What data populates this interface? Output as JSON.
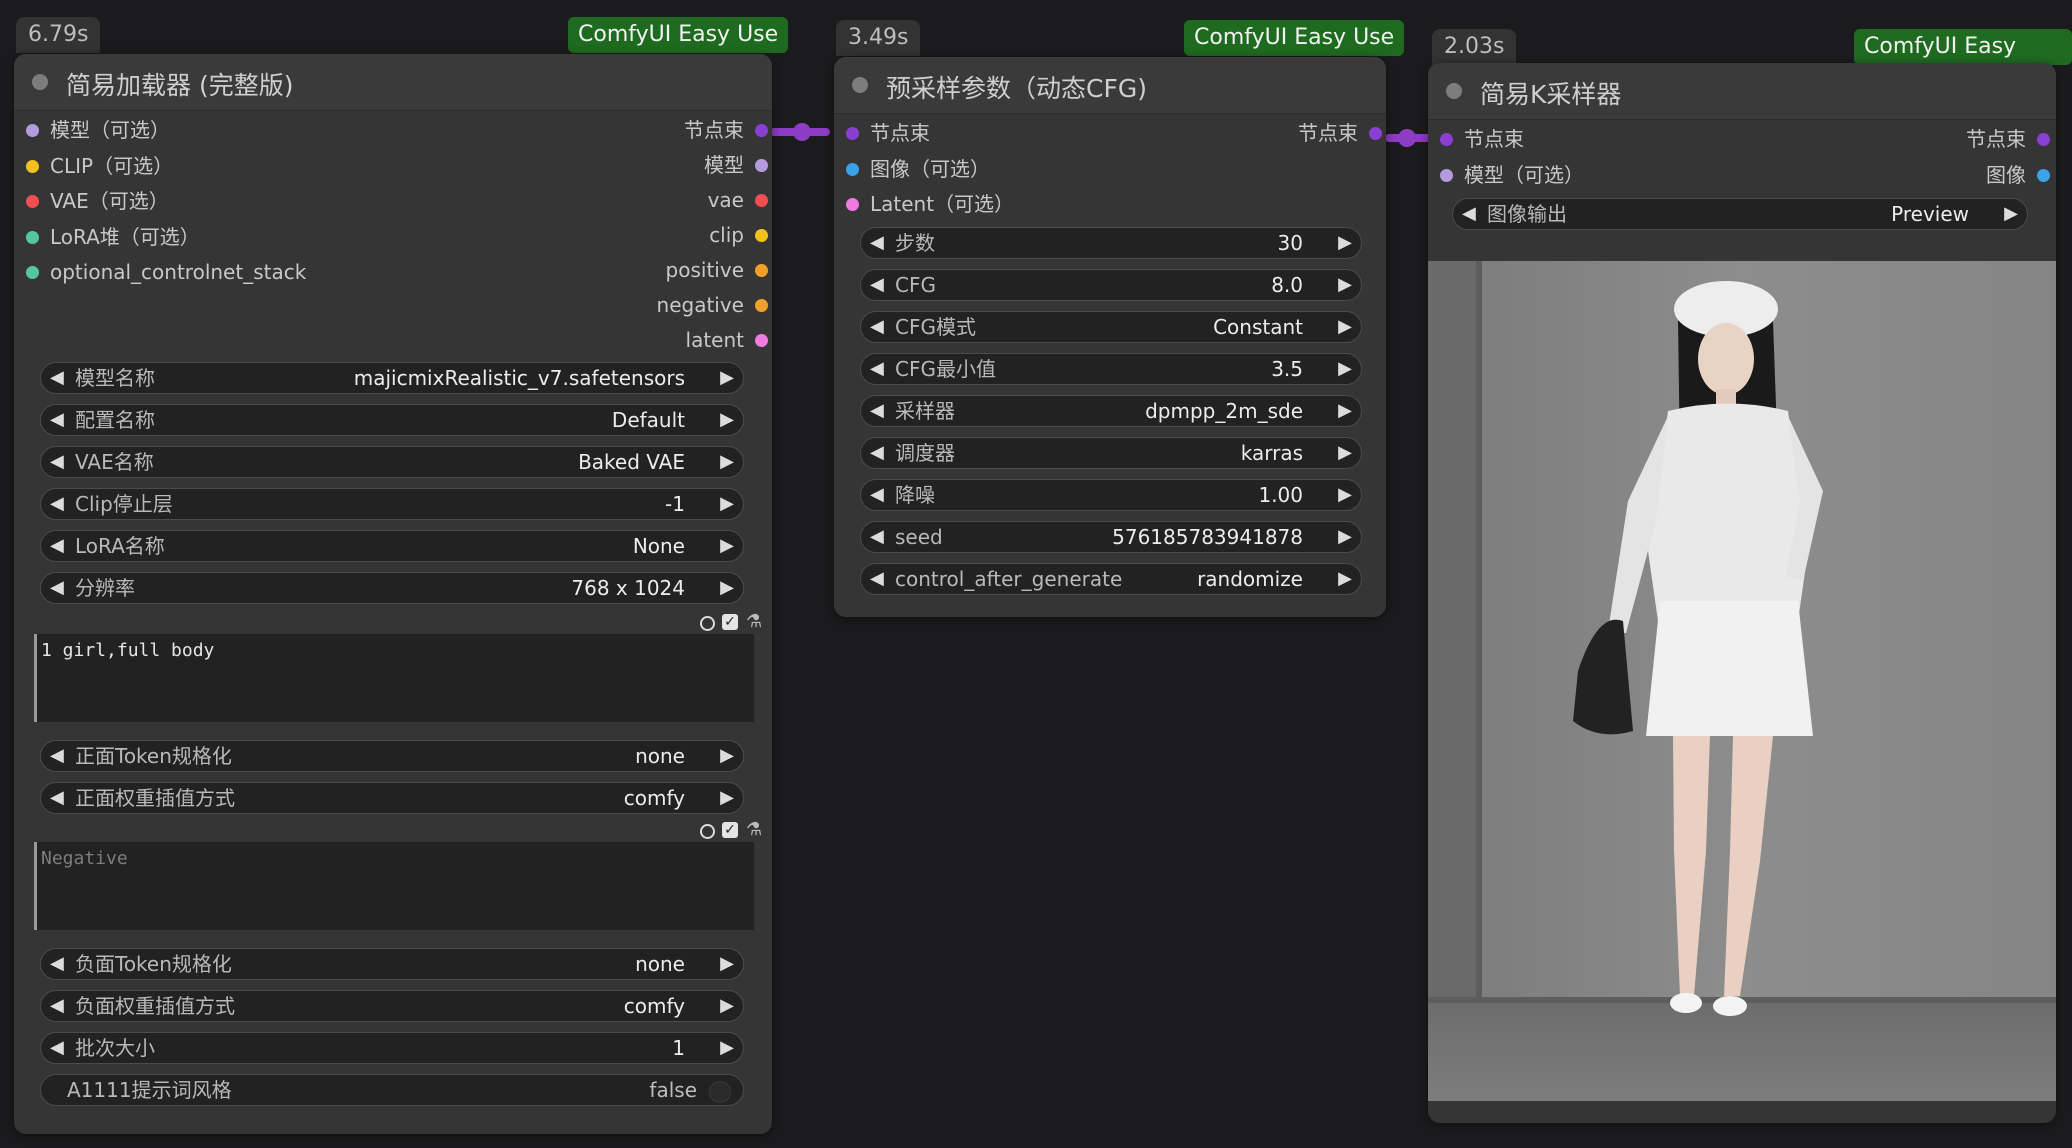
{
  "colors": {
    "purple_slot": "#8a3fd3",
    "lavender_slot": "#b49be0",
    "yellow_slot": "#f0c21b",
    "red_slot": "#ef5050",
    "teal_slot": "#56c6a0",
    "blue_slot": "#3aa3e8",
    "pink_slot": "#ef7be0",
    "orange_slot": "#f0a029",
    "badge_bg": "#1e6b1f",
    "link": "#8e3cc5"
  },
  "loader": {
    "time": "6.79s",
    "badge": "ComfyUI Easy Use",
    "title": "简易加载器 (完整版)",
    "inputs": [
      {
        "label": "模型（可选）",
        "color": "#b49be0"
      },
      {
        "label": "CLIP（可选）",
        "color": "#f0c21b"
      },
      {
        "label": "VAE（可选）",
        "color": "#ef5050"
      },
      {
        "label": "LoRA堆（可选）",
        "color": "#56c6a0"
      },
      {
        "label": "optional_controlnet_stack",
        "color": "#56c6a0"
      }
    ],
    "outputs": [
      {
        "label": "节点束",
        "color": "#8a3fd3"
      },
      {
        "label": "模型",
        "color": "#b49be0"
      },
      {
        "label": "vae",
        "color": "#ef5050"
      },
      {
        "label": "clip",
        "color": "#f0c21b"
      },
      {
        "label": "positive",
        "color": "#f0a029"
      },
      {
        "label": "negative",
        "color": "#f0a029"
      },
      {
        "label": "latent",
        "color": "#ef7be0"
      }
    ],
    "widgets_a": [
      {
        "label": "模型名称",
        "value": "majicmixRealistic_v7.safetensors"
      },
      {
        "label": "配置名称",
        "value": "Default"
      },
      {
        "label": "VAE名称",
        "value": "Baked VAE"
      },
      {
        "label": "Clip停止层",
        "value": "-1"
      },
      {
        "label": "LoRA名称",
        "value": "None"
      },
      {
        "label": "分辨率",
        "value": "768 x 1024"
      }
    ],
    "positive_text": "1 girl,full body",
    "widgets_b": [
      {
        "label": "正面Token规格化",
        "value": "none"
      },
      {
        "label": "正面权重插值方式",
        "value": "comfy"
      }
    ],
    "negative_placeholder": "Negative",
    "widgets_c": [
      {
        "label": "负面Token规格化",
        "value": "none"
      },
      {
        "label": "负面权重插值方式",
        "value": "comfy"
      },
      {
        "label": "批次大小",
        "value": "1"
      }
    ],
    "toggle": {
      "label": "A1111提示词风格",
      "value": "false"
    }
  },
  "presampler": {
    "time": "3.49s",
    "badge": "ComfyUI Easy Use",
    "title": "预采样参数（动态CFG)",
    "inputs": [
      {
        "label": "节点束",
        "color": "#8a3fd3"
      },
      {
        "label": "图像（可选）",
        "color": "#3aa3e8"
      },
      {
        "label": "Latent（可选）",
        "color": "#ef7be0"
      }
    ],
    "outputs": [
      {
        "label": "节点束",
        "color": "#8a3fd3"
      }
    ],
    "widgets": [
      {
        "label": "步数",
        "value": "30"
      },
      {
        "label": "CFG",
        "value": "8.0"
      },
      {
        "label": "CFG模式",
        "value": "Constant"
      },
      {
        "label": "CFG最小值",
        "value": "3.5"
      },
      {
        "label": "采样器",
        "value": "dpmpp_2m_sde"
      },
      {
        "label": "调度器",
        "value": "karras"
      },
      {
        "label": "降噪",
        "value": "1.00"
      },
      {
        "label": "seed",
        "value": "576185783941878"
      },
      {
        "label": "control_after_generate",
        "value": "randomize"
      }
    ]
  },
  "ksampler": {
    "time": "2.03s",
    "badge": "ComfyUI Easy Use",
    "title": "简易K采样器",
    "inputs": [
      {
        "label": "节点束",
        "color": "#8a3fd3"
      },
      {
        "label": "模型（可选）",
        "color": "#b49be0"
      }
    ],
    "outputs": [
      {
        "label": "节点束",
        "color": "#8a3fd3"
      },
      {
        "label": "图像",
        "color": "#3aa3e8"
      }
    ],
    "widgets": [
      {
        "label": "图像输出",
        "value": "Preview"
      }
    ]
  }
}
